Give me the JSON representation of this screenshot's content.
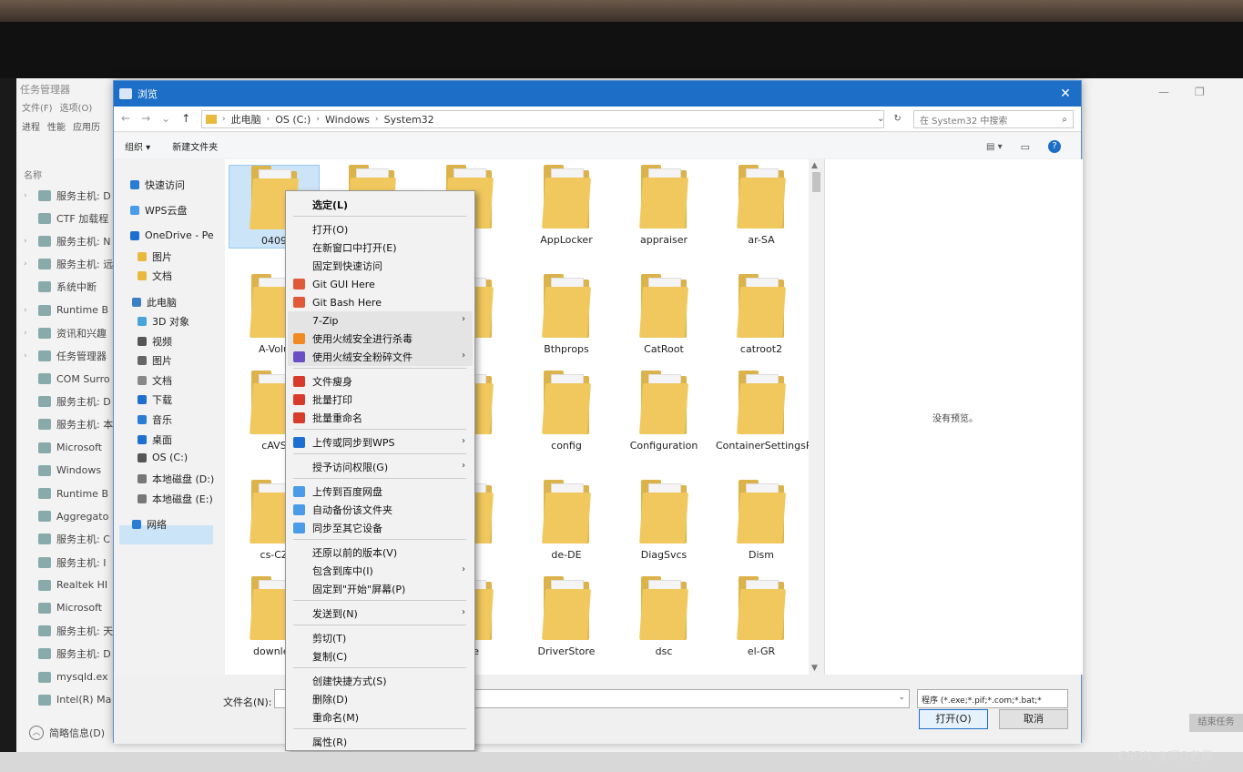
{
  "taskmanager": {
    "title": "任务管理器",
    "menu": [
      "文件(F)",
      "选项(O)"
    ],
    "tabs": [
      "进程",
      "性能",
      "应用历"
    ],
    "column": "名称",
    "footer": "简略信息(D)",
    "end_button": "结束任务",
    "rows": [
      {
        "label": "服务主机: D",
        "arrow": true
      },
      {
        "label": "CTF 加载程",
        "arrow": false
      },
      {
        "label": "服务主机: N",
        "arrow": true
      },
      {
        "label": "服务主机: 远",
        "arrow": true
      },
      {
        "label": "系统中断",
        "arrow": false
      },
      {
        "label": "Runtime B",
        "arrow": true
      },
      {
        "label": "资讯和兴趣",
        "arrow": true
      },
      {
        "label": "任务管理器",
        "arrow": true
      },
      {
        "label": "COM Surro",
        "arrow": false
      },
      {
        "label": "服务主机: D",
        "arrow": false
      },
      {
        "label": "服务主机: 本",
        "arrow": false
      },
      {
        "label": "Microsoft",
        "arrow": false
      },
      {
        "label": "Windows",
        "arrow": false
      },
      {
        "label": "Runtime B",
        "arrow": false
      },
      {
        "label": "Aggregato",
        "arrow": false
      },
      {
        "label": "服务主机: C",
        "arrow": false
      },
      {
        "label": "服务主机: I",
        "arrow": false
      },
      {
        "label": "Realtek HI",
        "arrow": false
      },
      {
        "label": "Microsoft",
        "arrow": false
      },
      {
        "label": "服务主机: 天",
        "arrow": false
      },
      {
        "label": "服务主机: D",
        "arrow": false
      },
      {
        "label": "mysqld.ex",
        "arrow": false
      },
      {
        "label": "Intel(R) Ma",
        "arrow": false
      }
    ]
  },
  "dialog": {
    "title": "浏览",
    "close": "✕",
    "breadcrumb": [
      "此电脑",
      "OS (C:)",
      "Windows",
      "System32"
    ],
    "search_placeholder": "在 System32 中搜索",
    "toolbar": {
      "organize": "组织 ▾",
      "new_folder": "新建文件夹"
    },
    "nav": [
      {
        "label": "快速访问",
        "color": "#2b7cd3"
      },
      {
        "label": "WPS云盘",
        "color": "#4a9be8"
      },
      {
        "label": "OneDrive - Pe",
        "color": "#1e6fd0"
      },
      {
        "label": "图片",
        "color": "#e8b93e"
      },
      {
        "label": "文档",
        "color": "#e8b93e"
      },
      {
        "label": "此电脑",
        "color": "#3b7fc4"
      },
      {
        "label": "3D 对象",
        "color": "#4aa3d8"
      },
      {
        "label": "视频",
        "color": "#555"
      },
      {
        "label": "图片",
        "color": "#666"
      },
      {
        "label": "文档",
        "color": "#888"
      },
      {
        "label": "下载",
        "color": "#1e6fd0"
      },
      {
        "label": "音乐",
        "color": "#2b7cd3"
      },
      {
        "label": "桌面",
        "color": "#1e6fd0"
      },
      {
        "label": "OS (C:)",
        "color": "#555"
      },
      {
        "label": "本地磁盘 (D:)",
        "color": "#777"
      },
      {
        "label": "本地磁盘 (E:)",
        "color": "#777"
      },
      {
        "label": "网络",
        "color": "#2b7cd3"
      }
    ],
    "folders": [
      "0409",
      "",
      "",
      "AppLocker",
      "appraiser",
      "ar-SA",
      "A-Volu",
      "",
      "",
      "Bthprops",
      "CatRoot",
      "catroot2",
      "cAVS",
      "",
      "",
      "config",
      "Configuration",
      "ContainerSettingsProviders",
      "cs-CZ",
      "",
      "",
      "de-DE",
      "DiagSvcs",
      "Dism",
      "downlev",
      "",
      "tate",
      "DriverStore",
      "dsc",
      "el-GR"
    ],
    "preview_text": "没有预览。",
    "filename_label": "文件名(N):",
    "filter": "程序 (*.exe;*.pif;*.com;*.bat;*",
    "open_button": "打开(O)",
    "cancel_button": "取消"
  },
  "context_menu": [
    {
      "label": "选定(L)",
      "bold": true
    },
    {
      "sep": true
    },
    {
      "label": "打开(O)"
    },
    {
      "label": "在新窗口中打开(E)"
    },
    {
      "label": "固定到快速访问"
    },
    {
      "label": "Git GUI Here",
      "icon": "#e05a3a"
    },
    {
      "label": "Git Bash Here",
      "icon": "#e05a3a"
    },
    {
      "label": "7-Zip",
      "sub": true,
      "hl": true
    },
    {
      "label": "使用火绒安全进行杀毒",
      "icon": "#f08a24",
      "hl": true
    },
    {
      "label": "使用火绒安全粉碎文件",
      "icon": "#6a4fc4",
      "sub": true,
      "hl": true
    },
    {
      "sep": true
    },
    {
      "label": "文件瘦身",
      "icon": "#d93b2b"
    },
    {
      "label": "批量打印",
      "icon": "#d93b2b"
    },
    {
      "label": "批量重命名",
      "icon": "#d93b2b"
    },
    {
      "sep": true
    },
    {
      "label": "上传或同步到WPS",
      "icon": "#1e6fd0",
      "sub": true
    },
    {
      "sep": true
    },
    {
      "label": "授予访问权限(G)",
      "sub": true
    },
    {
      "sep": true
    },
    {
      "label": "上传到百度网盘",
      "icon": "#4a9be8"
    },
    {
      "label": "自动备份该文件夹",
      "icon": "#4a9be8"
    },
    {
      "label": "同步至其它设备",
      "icon": "#4a9be8"
    },
    {
      "sep": true
    },
    {
      "label": "还原以前的版本(V)"
    },
    {
      "label": "包含到库中(I)",
      "sub": true
    },
    {
      "label": "固定到\"开始\"屏幕(P)"
    },
    {
      "sep": true
    },
    {
      "label": "发送到(N)",
      "sub": true
    },
    {
      "sep": true
    },
    {
      "label": "剪切(T)"
    },
    {
      "label": "复制(C)"
    },
    {
      "sep": true
    },
    {
      "label": "创建快捷方式(S)"
    },
    {
      "label": "删除(D)"
    },
    {
      "label": "重命名(M)"
    },
    {
      "sep": true
    },
    {
      "label": "属性(R)"
    }
  ],
  "watermark": "CSDN @啊Q老师"
}
